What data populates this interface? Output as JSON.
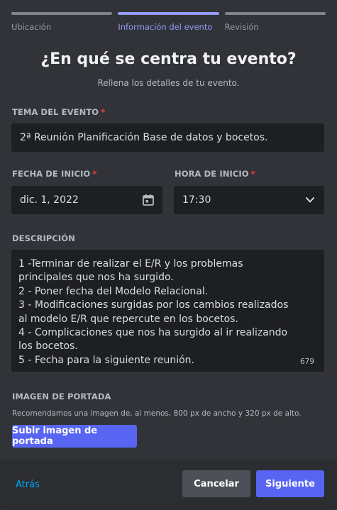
{
  "steps": [
    {
      "label": "Ubicación",
      "active": false
    },
    {
      "label": "Información del evento",
      "active": true
    },
    {
      "label": "Revisión",
      "active": false
    }
  ],
  "header": {
    "title": "¿En qué se centra tu evento?",
    "subtitle": "Rellena los detalles de tu evento."
  },
  "topic": {
    "label": "TEMA DEL EVENTO",
    "required_mark": "*",
    "value": "2ª Reunión Planificación Base de datos y bocetos."
  },
  "start_date": {
    "label": "FECHA DE INICIO",
    "required_mark": "*",
    "value": "dic. 1, 2022",
    "icon": "calendar-icon"
  },
  "start_time": {
    "label": "HORA DE INICIO",
    "required_mark": "*",
    "value": "17:30",
    "icon": "chevron-down-icon"
  },
  "description": {
    "label": "DESCRIPCIÓN",
    "value": "1 -Terminar de realizar el E/R y los problemas principales que nos ha surgido.\n2 - Poner fecha del Modelo Relacional.\n3 - Modificaciones surgidas por los cambios realizados al modelo E/R que repercute en los bocetos.\n4 - Complicaciones que nos ha surgido al ir realizando los bocetos.\n5 - Fecha para la siguiente reunión.",
    "remaining_chars": "679"
  },
  "cover": {
    "label": "IMAGEN DE PORTADA",
    "hint": "Recomendamos una imagen de, al menos, 800 px de ancho y 320 px de alto.",
    "upload_label": "Subir imagen de portada"
  },
  "footer": {
    "back_label": "Atrás",
    "cancel_label": "Cancelar",
    "next_label": "Siguiente"
  },
  "colors": {
    "accent": "#5865f2",
    "active_step": "#949cf7",
    "required": "#f23f43",
    "link": "#00a8fc",
    "background": "#313338",
    "input": "#1e1f22"
  }
}
